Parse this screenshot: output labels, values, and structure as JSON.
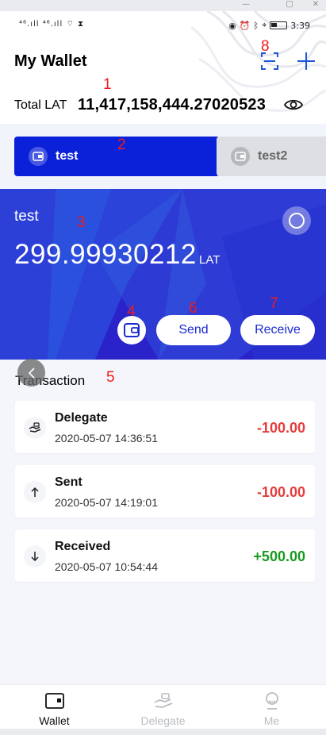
{
  "window": {
    "minimize": "—",
    "maximize": "□",
    "close": "✕"
  },
  "status_bar": {
    "signal_left": "⁴⁶.ıll ⁴⁶.ıll",
    "time": "3:39"
  },
  "header": {
    "title": "My Wallet",
    "scan_icon": "scan-icon",
    "add_icon": "plus-icon"
  },
  "total": {
    "label": "Total LAT",
    "value": "11,417,158,444.27020523",
    "eye_icon": "eye-icon"
  },
  "wallet_tabs": [
    {
      "label": "test",
      "active": true
    },
    {
      "label": "test2",
      "active": false
    }
  ],
  "card": {
    "name": "test",
    "balance": "299.99930212",
    "unit": "LAT",
    "send_label": "Send",
    "receive_label": "Receive",
    "color": "#2a23c9"
  },
  "transactions": {
    "title": "Transaction",
    "items": [
      {
        "type": "Delegate",
        "time": "2020-05-07 14:36:51",
        "amount": "-100.00",
        "direction": "out",
        "icon": "delegate-icon"
      },
      {
        "type": "Sent",
        "time": "2020-05-07 14:19:01",
        "amount": "-100.00",
        "direction": "out",
        "icon": "arrow-up-icon"
      },
      {
        "type": "Received",
        "time": "2020-05-07 10:54:44",
        "amount": "+500.00",
        "direction": "in",
        "icon": "arrow-down-icon"
      }
    ]
  },
  "bottom_nav": [
    {
      "label": "Wallet",
      "active": true,
      "icon": "wallet-icon"
    },
    {
      "label": "Delegate",
      "active": false,
      "icon": "delegate-hand-icon"
    },
    {
      "label": "Me",
      "active": false,
      "icon": "profile-icon"
    }
  ],
  "annotations": [
    "1",
    "2",
    "3",
    "4",
    "5",
    "6",
    "7",
    "8"
  ],
  "colors": {
    "primary": "#0b21d9",
    "negative": "#e43d3d",
    "positive": "#1b9a22",
    "annotation": "#ee1c1c"
  }
}
